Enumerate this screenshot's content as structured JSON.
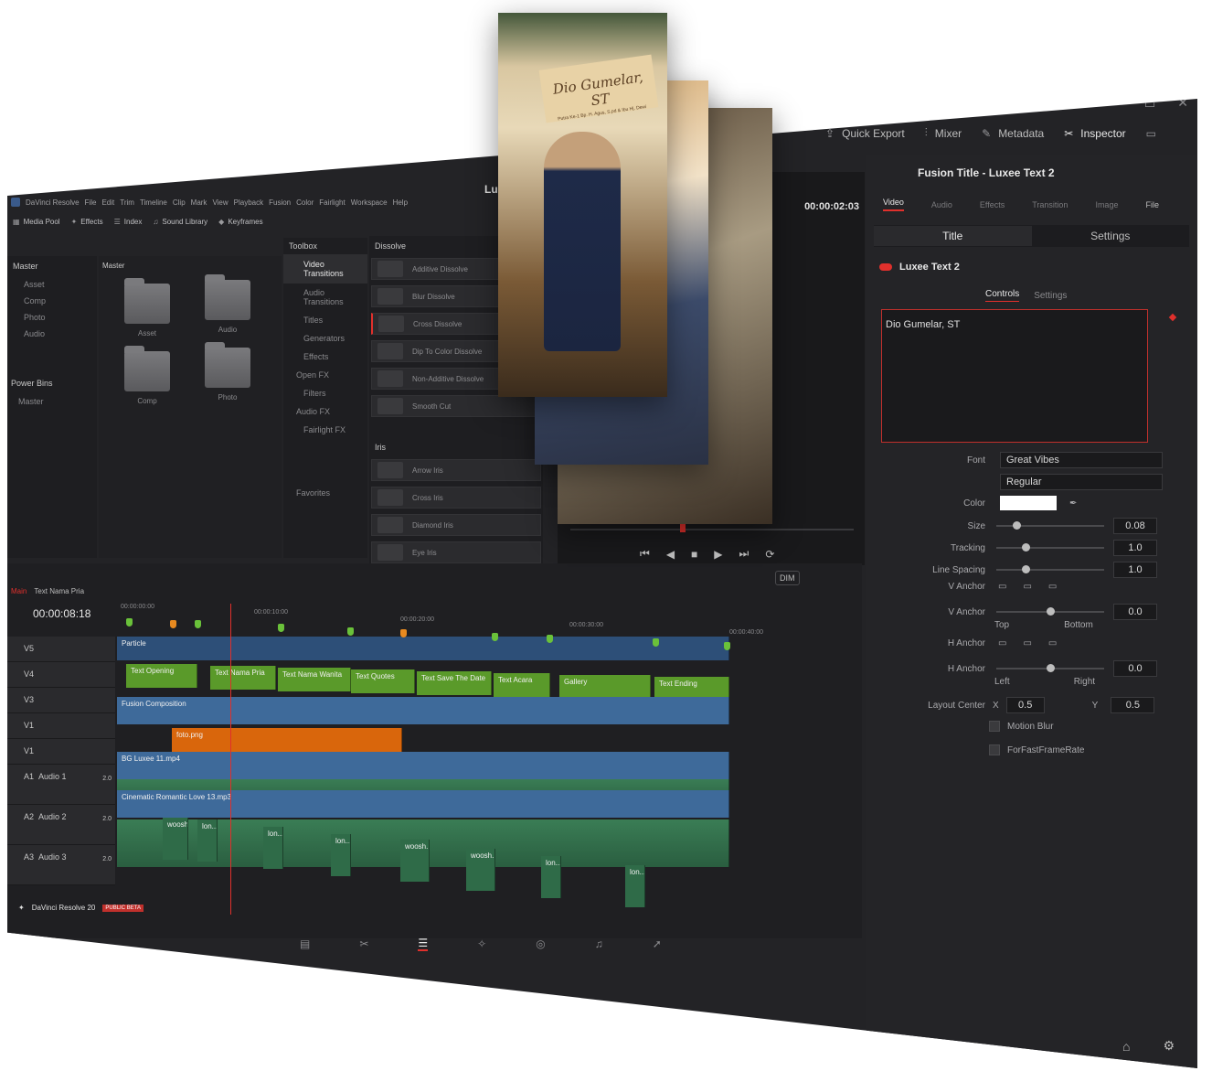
{
  "app": {
    "name": "DaVinci Resolve",
    "project_title_partial": "Lu",
    "menu": [
      "File",
      "Edit",
      "Trim",
      "Timeline",
      "Clip",
      "Mark",
      "View",
      "Playback",
      "Fusion",
      "Color",
      "Fairlight",
      "Workspace",
      "Help"
    ],
    "brand": "DaVinci Resolve 20",
    "beta_badge": "PUBLIC BETA"
  },
  "toolbar": {
    "media_pool": "Media Pool",
    "effects": "Effects",
    "index": "Index",
    "sound_library": "Sound Library",
    "keyframes": "Keyframes",
    "quick_export": "Quick Export",
    "mixer": "Mixer",
    "metadata": "Metadata",
    "inspector": "Inspector"
  },
  "media_pool": {
    "root": "Master",
    "bins": [
      "Asset",
      "Comp",
      "Photo",
      "Audio"
    ],
    "power_bins": "Power Bins",
    "power_bins_child": "Master",
    "grid_header": "Master",
    "folders": [
      "Asset",
      "Audio",
      "Comp",
      "Photo"
    ]
  },
  "effects": {
    "toolbox": "Toolbox",
    "categories": [
      "Video Transitions",
      "Audio Transitions",
      "Titles",
      "Generators",
      "Effects",
      "Open FX",
      "Filters",
      "Audio FX",
      "Fairlight FX"
    ],
    "favorites": "Favorites",
    "dissolve_header": "Dissolve",
    "dissolve": [
      "Additive Dissolve",
      "Blur Dissolve",
      "Cross Dissolve",
      "Dip To Color Dissolve",
      "Non-Additive Dissolve",
      "Smooth Cut"
    ],
    "iris_header": "Iris",
    "iris": [
      "Arrow Iris",
      "Cross Iris",
      "Diamond Iris",
      "Eye Iris"
    ]
  },
  "viewer": {
    "timecode": "00:00:02:03",
    "card_name": "Dio Gumelar, ST",
    "card_subtitle": "Putra Ke-1 Bp. H. Agus, S.pd & Ibu Hj. Dewi"
  },
  "inspector": {
    "title": "Fusion Title - Luxee Text 2",
    "tabs": [
      "Video",
      "Audio",
      "Effects",
      "Transition",
      "Image",
      "File"
    ],
    "subtabs": [
      "Title",
      "Settings"
    ],
    "node_name": "Luxee Text 2",
    "inner_tabs": [
      "Controls",
      "Settings"
    ],
    "text_value": "Dio Gumelar, ST",
    "font_label": "Font",
    "font": "Great Vibes",
    "style": "Regular",
    "color_label": "Color",
    "size_label": "Size",
    "size": "0.08",
    "tracking_label": "Tracking",
    "tracking": "1.0",
    "line_spacing_label": "Line Spacing",
    "line_spacing": "1.0",
    "v_anchor_label": "V Anchor",
    "v_anchor2_label": "V Anchor",
    "v_anchor_value": "0.0",
    "v_top": "Top",
    "v_bottom": "Bottom",
    "h_anchor_label": "H Anchor",
    "h_anchor2_label": "H Anchor",
    "h_anchor_value": "0.0",
    "h_left": "Left",
    "h_right": "Right",
    "layout_center_label": "Layout Center",
    "x_label": "X",
    "x": "0.5",
    "y_label": "Y",
    "y": "0.5",
    "motion_blur": "Motion Blur",
    "for_fast": "ForFastFrameRate"
  },
  "timeline": {
    "tabs": [
      "Main",
      "Text Nama Pria"
    ],
    "timecode": "00:00:08:18",
    "dim": "DIM",
    "ruler": [
      "00:00:00:00",
      "00:00:10:00",
      "00:00:20:00",
      "00:00:30:00",
      "00:00:40:00"
    ],
    "tracks": [
      "V5",
      "V4",
      "V3",
      "V1",
      "V1",
      "A1",
      "A2",
      "A3"
    ],
    "audio_names": [
      "Audio 1",
      "Audio 2",
      "Audio 3"
    ],
    "audio_level": "2.0",
    "clips": {
      "particle": "Particle",
      "v4": [
        "Text Opening",
        "Text Nama Pria",
        "Text Nama Wanita",
        "Text Quotes",
        "Text Save The Date",
        "Text Acara",
        "Gallery",
        "Text Ending"
      ],
      "fusion": "Fusion Composition",
      "foto": "foto.png",
      "bg": "BG Luxee 11.mp4",
      "music": "Cinematic Romantic Love 13.mp3",
      "sfx": [
        "woosh...",
        "lon...",
        "lon...",
        "lon...",
        "woosh...",
        "woosh...",
        "lon...",
        "lon..."
      ]
    }
  },
  "colors": {
    "accent_red": "#e0302c",
    "clip_green": "#5a9a2a",
    "clip_blue": "#3e6a9a",
    "clip_orange": "#d9660c",
    "audio_green": "#2f6b48"
  }
}
